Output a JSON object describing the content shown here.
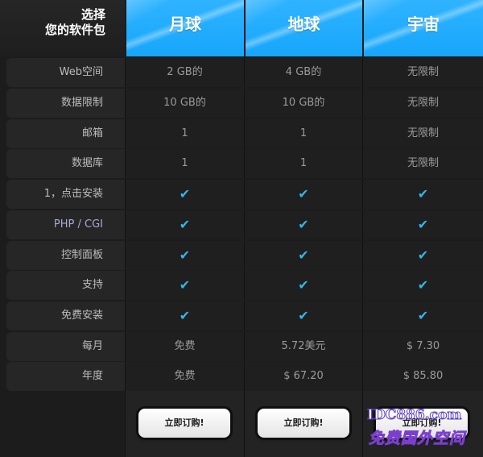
{
  "header": {
    "corner_line1": "选择",
    "corner_line2": "您的软件包",
    "plans": [
      "月球",
      "地球",
      "宇宙"
    ]
  },
  "rows": [
    {
      "label": "Web空间",
      "values": [
        "2 GB的",
        "4 GB的",
        "无限制"
      ]
    },
    {
      "label": "数据限制",
      "values": [
        "10 GB的",
        "10 GB的",
        "无限制"
      ]
    },
    {
      "label": "邮箱",
      "values": [
        "1",
        "1",
        "无限制"
      ]
    },
    {
      "label": "数据库",
      "values": [
        "1",
        "1",
        "无限制"
      ]
    },
    {
      "label": "1，点击安装",
      "values": [
        "✔",
        "✔",
        "✔"
      ]
    },
    {
      "label": "PHP / CGI",
      "values": [
        "✔",
        "✔",
        "✔"
      ]
    },
    {
      "label": "控制面板",
      "values": [
        "✔",
        "✔",
        "✔"
      ]
    },
    {
      "label": "支持",
      "values": [
        "✔",
        "✔",
        "✔"
      ]
    },
    {
      "label": "免费安装",
      "values": [
        "✔",
        "✔",
        "✔"
      ]
    },
    {
      "label": "每月",
      "values": [
        "免费",
        "5.72美元",
        "$ 7.30"
      ]
    },
    {
      "label": "年度",
      "values": [
        "免费",
        "$ 67.20",
        "$ 85.80"
      ]
    }
  ],
  "footer": {
    "order_label": "立即订购!"
  },
  "watermark": {
    "line1": "IDC886.com",
    "line2": "免费国外空间"
  },
  "colors": {
    "header_blue": "#1aa8fd",
    "check": "#35b6ea"
  }
}
